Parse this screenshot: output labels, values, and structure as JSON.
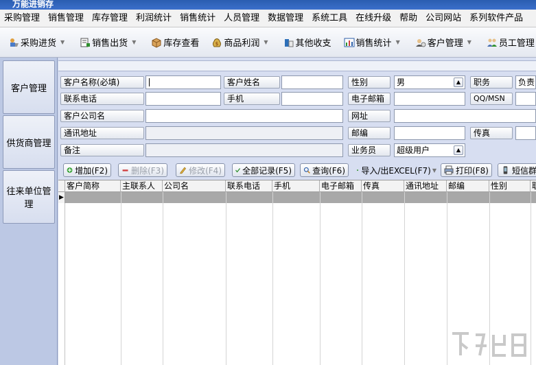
{
  "window": {
    "title": "万能进销存"
  },
  "menu": [
    "采购管理",
    "销售管理",
    "库存管理",
    "利润统计",
    "销售统计",
    "人员管理",
    "数据管理",
    "系统工具",
    "在线升级",
    "帮助",
    "公司网站",
    "系列软件产品"
  ],
  "toolbar": [
    {
      "label": "采购进货",
      "icon": "purchase-icon",
      "dropdown": true
    },
    {
      "label": "销售出货",
      "icon": "sales-icon",
      "dropdown": true
    },
    {
      "label": "库存查看",
      "icon": "inventory-box-icon",
      "dropdown": false
    },
    {
      "label": "商品利润",
      "icon": "profit-money-icon",
      "dropdown": true
    },
    {
      "label": "其他收支",
      "icon": "income-expense-icon",
      "dropdown": false
    },
    {
      "label": "销售统计",
      "icon": "sales-chart-icon",
      "dropdown": true
    },
    {
      "label": "客户管理",
      "icon": "customer-icon",
      "dropdown": true
    },
    {
      "label": "员工管理",
      "icon": "employee-icon",
      "dropdown": false
    }
  ],
  "sidebar": [
    "客户管理",
    "供货商管理",
    "往来单位管理"
  ],
  "form": {
    "customer_name_label": "客户名称(必填)",
    "customer_name_value": "",
    "contact_name_label": "客户姓名",
    "contact_name_value": "",
    "gender_label": "性别",
    "gender_value": "男",
    "title_label": "职务",
    "title_value": "负责",
    "phone_label": "联系电话",
    "phone_value": "",
    "mobile_label": "手机",
    "mobile_value": "",
    "email_label": "电子邮箱",
    "email_value": "",
    "qq_label": "QQ/MSN",
    "qq_value": "",
    "company_label": "客户公司名",
    "company_value": "",
    "website_label": "网址",
    "website_value": "",
    "address_label": "通讯地址",
    "address_value": "",
    "zip_label": "邮编",
    "zip_value": "",
    "fax_label": "传真",
    "fax_value": "",
    "note_label": "备注",
    "note_value": "",
    "salesman_label": "业务员",
    "salesman_value": "超级用户"
  },
  "actions": {
    "add": "增加(F2)",
    "delete": "删除(F3)",
    "edit": "修改(F4)",
    "all_records": "全部记录(F5)",
    "query": "查询(F6)",
    "import_export": "导入/出EXCEL(F7)",
    "print": "打印(F8)",
    "sms": "短信群"
  },
  "table": {
    "columns": [
      "客户简称",
      "主联系人",
      "公司名",
      "联系电话",
      "手机",
      "电子邮箱",
      "传真",
      "通讯地址",
      "邮编",
      "性别",
      "职"
    ],
    "rows": []
  },
  "colors": {
    "title_bar": "#2a5db0",
    "form_bg": "#d7def1",
    "sidebar_bg": "#bcc8e4",
    "selected_row": "#a8a8a8"
  }
}
